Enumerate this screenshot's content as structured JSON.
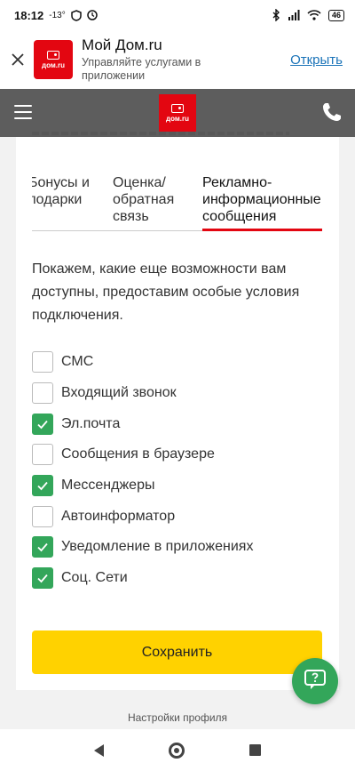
{
  "status_bar": {
    "time": "18:12",
    "temperature": "-13°",
    "battery": "46"
  },
  "app_banner": {
    "app_name": "Мой Дом.ru",
    "description": "Управляйте услугами в приложении",
    "open_label": "Открыть",
    "icon_text": "дом.ru"
  },
  "header": {
    "logo_text": "дом.ru"
  },
  "tabs": [
    {
      "label": "Бонусы и подарки",
      "active": false
    },
    {
      "label": "Оценка/ обратная связь",
      "active": false
    },
    {
      "label": "Рекламно-информационные сообщения",
      "active": true
    }
  ],
  "intro_text": "Покажем, какие еще возможности вам доступны, предоставим особые условия подключения.",
  "options": [
    {
      "label": "СМС",
      "checked": false
    },
    {
      "label": "Входящий звонок",
      "checked": false
    },
    {
      "label": "Эл.почта",
      "checked": true
    },
    {
      "label": "Сообщения в браузере",
      "checked": false
    },
    {
      "label": "Мессенджеры",
      "checked": true
    },
    {
      "label": "Автоинформатор",
      "checked": false
    },
    {
      "label": "Уведомление в приложениях",
      "checked": true
    },
    {
      "label": "Соц. Сети",
      "checked": true
    }
  ],
  "save_label": "Сохранить",
  "footer_text": "Настройки профиля",
  "colors": {
    "brand_red": "#e30611",
    "accent_yellow": "#ffd200",
    "check_green": "#33a65a",
    "header_gray": "#5d5d5d"
  }
}
